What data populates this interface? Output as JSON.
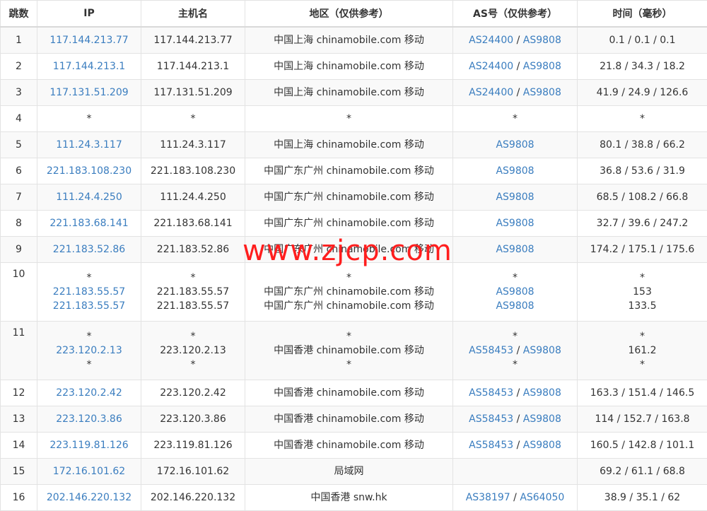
{
  "headers": [
    "跳数",
    "IP",
    "主机名",
    "地区（仅供参考）",
    "AS号（仅供参考）",
    "时间（毫秒）"
  ],
  "rows": [
    {
      "hop": "1",
      "ip": [
        "117.144.213.77"
      ],
      "host": [
        "117.144.213.77"
      ],
      "region": [
        "中国上海 chinamobile.com 移动"
      ],
      "as": [
        [
          "AS24400",
          "AS9808"
        ]
      ],
      "time": [
        "0.1 / 0.1 / 0.1"
      ]
    },
    {
      "hop": "2",
      "ip": [
        "117.144.213.1"
      ],
      "host": [
        "117.144.213.1"
      ],
      "region": [
        "中国上海 chinamobile.com 移动"
      ],
      "as": [
        [
          "AS24400",
          "AS9808"
        ]
      ],
      "time": [
        "21.8 / 34.3 / 18.2"
      ]
    },
    {
      "hop": "3",
      "ip": [
        "117.131.51.209"
      ],
      "host": [
        "117.131.51.209"
      ],
      "region": [
        "中国上海 chinamobile.com 移动"
      ],
      "as": [
        [
          "AS24400",
          "AS9808"
        ]
      ],
      "time": [
        "41.9 / 24.9 / 126.6"
      ]
    },
    {
      "hop": "4",
      "ip": [
        "*"
      ],
      "host": [
        "*"
      ],
      "region": [
        "*"
      ],
      "as": [
        [
          "*"
        ]
      ],
      "time": [
        "*"
      ]
    },
    {
      "hop": "5",
      "ip": [
        "111.24.3.117"
      ],
      "host": [
        "111.24.3.117"
      ],
      "region": [
        "中国上海 chinamobile.com 移动"
      ],
      "as": [
        [
          "AS9808"
        ]
      ],
      "time": [
        "80.1 / 38.8 / 66.2"
      ]
    },
    {
      "hop": "6",
      "ip": [
        "221.183.108.230"
      ],
      "host": [
        "221.183.108.230"
      ],
      "region": [
        "中国广东广州 chinamobile.com 移动"
      ],
      "as": [
        [
          "AS9808"
        ]
      ],
      "time": [
        "36.8 / 53.6 / 31.9"
      ]
    },
    {
      "hop": "7",
      "ip": [
        "111.24.4.250"
      ],
      "host": [
        "111.24.4.250"
      ],
      "region": [
        "中国广东广州 chinamobile.com 移动"
      ],
      "as": [
        [
          "AS9808"
        ]
      ],
      "time": [
        "68.5 / 108.2 / 66.8"
      ]
    },
    {
      "hop": "8",
      "ip": [
        "221.183.68.141"
      ],
      "host": [
        "221.183.68.141"
      ],
      "region": [
        "中国广东广州 chinamobile.com 移动"
      ],
      "as": [
        [
          "AS9808"
        ]
      ],
      "time": [
        "32.7 / 39.6 / 247.2"
      ]
    },
    {
      "hop": "9",
      "ip": [
        "221.183.52.86"
      ],
      "host": [
        "221.183.52.86"
      ],
      "region": [
        "中国广东广州 chinamobile.com 移动"
      ],
      "as": [
        [
          "AS9808"
        ]
      ],
      "time": [
        "174.2 / 175.1 / 175.6"
      ]
    },
    {
      "hop": "10",
      "ip": [
        "*",
        "221.183.55.57",
        "221.183.55.57"
      ],
      "host": [
        "*",
        "221.183.55.57",
        "221.183.55.57"
      ],
      "region": [
        "*",
        "中国广东广州 chinamobile.com 移动",
        "中国广东广州 chinamobile.com 移动"
      ],
      "as": [
        [
          "*"
        ],
        [
          "AS9808"
        ],
        [
          "AS9808"
        ]
      ],
      "time": [
        "*",
        "153",
        "133.5"
      ]
    },
    {
      "hop": "11",
      "ip": [
        "*",
        "223.120.2.13",
        "*"
      ],
      "host": [
        "*",
        "223.120.2.13",
        "*"
      ],
      "region": [
        "*",
        "中国香港 chinamobile.com 移动",
        "*"
      ],
      "as": [
        [
          "*"
        ],
        [
          "AS58453",
          "AS9808"
        ],
        [
          "*"
        ]
      ],
      "time": [
        "*",
        "161.2",
        "*"
      ]
    },
    {
      "hop": "12",
      "ip": [
        "223.120.2.42"
      ],
      "host": [
        "223.120.2.42"
      ],
      "region": [
        "中国香港 chinamobile.com 移动"
      ],
      "as": [
        [
          "AS58453",
          "AS9808"
        ]
      ],
      "time": [
        "163.3 / 151.4 / 146.5"
      ]
    },
    {
      "hop": "13",
      "ip": [
        "223.120.3.86"
      ],
      "host": [
        "223.120.3.86"
      ],
      "region": [
        "中国香港 chinamobile.com 移动"
      ],
      "as": [
        [
          "AS58453",
          "AS9808"
        ]
      ],
      "time": [
        "114 / 152.7 / 163.8"
      ]
    },
    {
      "hop": "14",
      "ip": [
        "223.119.81.126"
      ],
      "host": [
        "223.119.81.126"
      ],
      "region": [
        "中国香港 chinamobile.com 移动"
      ],
      "as": [
        [
          "AS58453",
          "AS9808"
        ]
      ],
      "time": [
        "160.5 / 142.8 / 101.1"
      ]
    },
    {
      "hop": "15",
      "ip": [
        "172.16.101.62"
      ],
      "host": [
        "172.16.101.62"
      ],
      "region": [
        "局域网"
      ],
      "as": [
        []
      ],
      "time": [
        "69.2 / 61.1 / 68.8"
      ]
    },
    {
      "hop": "16",
      "ip": [
        "202.146.220.132"
      ],
      "host": [
        "202.146.220.132"
      ],
      "region": [
        "中国香港 snw.hk"
      ],
      "as": [
        [
          "AS38197",
          "AS64050"
        ]
      ],
      "time": [
        "38.9 / 35.1 / 62"
      ]
    }
  ],
  "watermark": "www.zjcp.com",
  "colors": {
    "link": "#3a7dbf",
    "watermark": "#ff1e1e",
    "stripe": "#f9f9f9",
    "border": "#e3e3e3"
  }
}
